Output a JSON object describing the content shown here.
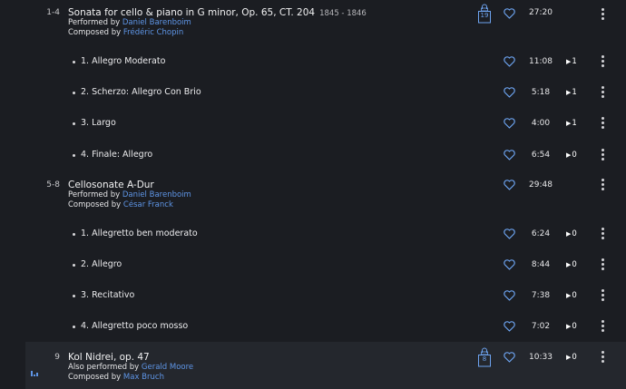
{
  "colors": {
    "background": "#1b1d22",
    "active_row": "#24272d",
    "accent": "#5e95e6",
    "text": "#e8e8ea"
  },
  "works": [
    {
      "number": "1-4",
      "title": "Sonata for cello & piano in G minor, Op. 65, CT. 204",
      "years": "1845 - 1846",
      "performer_prefix": "Performed by",
      "performer": "Daniel Barenboim",
      "composer_prefix": "Composed by",
      "composer": "Frédéric Chopin",
      "lock_count": "19",
      "duration": "27:20",
      "movements": [
        {
          "title": "1. Allegro Moderato",
          "duration": "11:08",
          "plays": "1"
        },
        {
          "title": "2. Scherzo: Allegro Con Brio",
          "duration": "5:18",
          "plays": "1"
        },
        {
          "title": "3. Largo",
          "duration": "4:00",
          "plays": "1"
        },
        {
          "title": "4. Finale: Allegro",
          "duration": "6:54",
          "plays": "0"
        }
      ]
    },
    {
      "number": "5-8",
      "title": "Cellosonate A-Dur",
      "performer_prefix": "Performed by",
      "performer": "Daniel Barenboim",
      "composer_prefix": "Composed by",
      "composer": "César Franck",
      "duration": "29:48",
      "movements": [
        {
          "title": "1. Allegretto ben moderato",
          "duration": "6:24",
          "plays": "0"
        },
        {
          "title": "2. Allegro",
          "duration": "8:44",
          "plays": "0"
        },
        {
          "title": "3. Recitativo",
          "duration": "7:38",
          "plays": "0"
        },
        {
          "title": "4. Allegretto poco mosso",
          "duration": "7:02",
          "plays": "0"
        }
      ]
    },
    {
      "number": "9",
      "title": "Kol Nidrei, op. 47",
      "performer_prefix": "Also performed by",
      "performer": "Gerald Moore",
      "composer_prefix": "Composed by",
      "composer": "Max Bruch",
      "lock_count": "8",
      "duration": "10:33",
      "plays": "0"
    }
  ],
  "icons": {
    "favorite": "heart-icon",
    "more": "kebab-menu-icon",
    "locked": "lock-icon",
    "play_count": "play-triangle-icon",
    "now_playing": "equalizer-icon"
  }
}
